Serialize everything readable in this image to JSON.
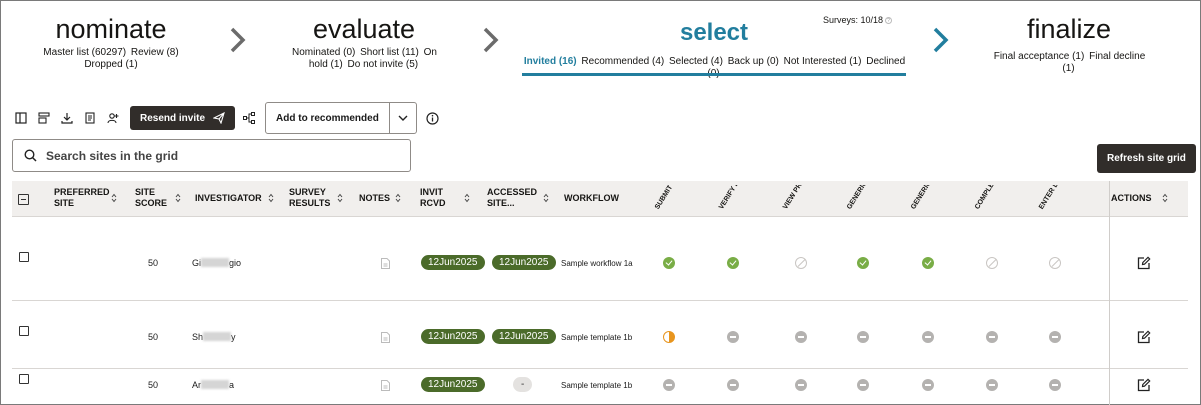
{
  "stages": [
    {
      "title": "nominate",
      "links": [
        "Master list (60297)",
        "Review (8)",
        "Dropped (1)"
      ]
    },
    {
      "title": "evaluate",
      "links": [
        "Nominated (0)",
        "Short list (11)",
        "On hold (1)",
        "Do not invite (5)"
      ]
    },
    {
      "title": "select",
      "links": [
        "Invited (16)",
        "Recommended (4)",
        "Selected (4)",
        "Back up (0)",
        "Not Interested (1)",
        "Declined (0)"
      ]
    },
    {
      "title": "finalize",
      "links": [
        "Final acceptance (1)",
        "Final decline (1)"
      ]
    }
  ],
  "surveys": "Surveys: 10/18",
  "survey_help": "?",
  "toolbar": {
    "resend_label": "Resend invite",
    "add_label": "Add to recommended"
  },
  "search": {
    "placeholder": "Search sites in the grid"
  },
  "refresh_label": "Refresh site grid",
  "columns": {
    "preferred": "PREFERRED SITE",
    "score": "SITE SCORE",
    "investigator": "INVESTIGATOR",
    "survey": "SURVEY RESULTS",
    "notes": "NOTES",
    "invit": "INVIT RCVD",
    "accessed": "ACCESSED SITE...",
    "workflow": "WORKFLOW",
    "rotated": [
      "SUBMIT CDA...",
      "VERIFY PARTICIPATI...",
      "VIEW PROTOCOL",
      "GENERIC DOCUME...",
      "GENERIC DOCUME...",
      "COMPLETE FEASIBILI...",
      "ENTER DATE..."
    ],
    "actions": "ACTIONS"
  },
  "rows": [
    {
      "score": "50",
      "inv_start": "Gi",
      "inv_end": "gio",
      "invit": "12Jun2025",
      "accessed": "12Jun2025",
      "workflow": "Sample workflow 1a",
      "status": [
        "ok",
        "ok",
        "na",
        "ok",
        "ok",
        "na",
        "na"
      ]
    },
    {
      "score": "50",
      "inv_start": "Sh",
      "inv_end": "y",
      "invit": "12Jun2025",
      "accessed": "12Jun2025",
      "workflow": "Sample template 1b",
      "status": [
        "half",
        "dash",
        "dash",
        "dash",
        "dash",
        "dash",
        "dash"
      ]
    },
    {
      "score": "50",
      "inv_start": "Ar",
      "inv_end": "a",
      "invit": "12Jun2025",
      "accessed": "-",
      "workflow": "Sample template 1b",
      "status": [
        "dash",
        "dash",
        "dash",
        "dash",
        "dash",
        "dash",
        "dash"
      ]
    }
  ],
  "colors": {
    "accent": "#227e9e",
    "pill": "#4b6b2a",
    "ok": "#79ad46",
    "partial": "#e8951e"
  }
}
